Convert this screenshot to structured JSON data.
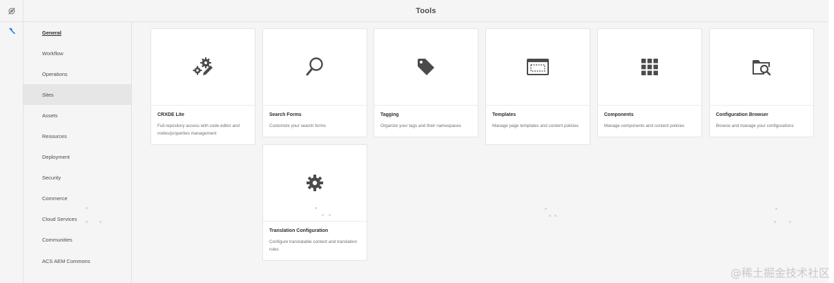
{
  "header": {
    "title": "Tools"
  },
  "rail": {
    "top_icon": "eye-slash-icon",
    "tools_icon": "hammer-icon"
  },
  "sidebar": {
    "items": [
      {
        "label": "General"
      },
      {
        "label": "Workflow"
      },
      {
        "label": "Operations"
      },
      {
        "label": "Sites"
      },
      {
        "label": "Assets"
      },
      {
        "label": "Resources"
      },
      {
        "label": "Deployment"
      },
      {
        "label": "Security"
      },
      {
        "label": "Commerce"
      },
      {
        "label": "Cloud Services"
      },
      {
        "label": "Communities"
      },
      {
        "label": "ACS AEM Commons"
      }
    ],
    "active_item": "General",
    "selected_item": "Sites"
  },
  "cards": [
    {
      "title": "CRXDE Lite",
      "description": "Full repository access with code editor and nodes/properties management",
      "icon": "gears-pencil-icon"
    },
    {
      "title": "Search Forms",
      "description": "Customize your search forms",
      "icon": "search-icon"
    },
    {
      "title": "Tagging",
      "description": "Organize your tags and their namespaces",
      "icon": "tag-icon"
    },
    {
      "title": "Templates",
      "description": "Manage page templates and content policies",
      "icon": "template-icon"
    },
    {
      "title": "Components",
      "description": "Manage components and content policies",
      "icon": "grid-icon"
    },
    {
      "title": "Configuration Browser",
      "description": "Browse and manage your configurations",
      "icon": "folder-search-icon"
    },
    {
      "title": "Translation Configuration",
      "description": "Configure translatable content and translation rules",
      "icon": "gear-icon"
    }
  ],
  "watermark": "@稀土掘金技术社区",
  "colors": {
    "background": "#f5f5f5",
    "card": "#ffffff",
    "icon": "#4b4b4b",
    "accent": "#1473e6"
  }
}
